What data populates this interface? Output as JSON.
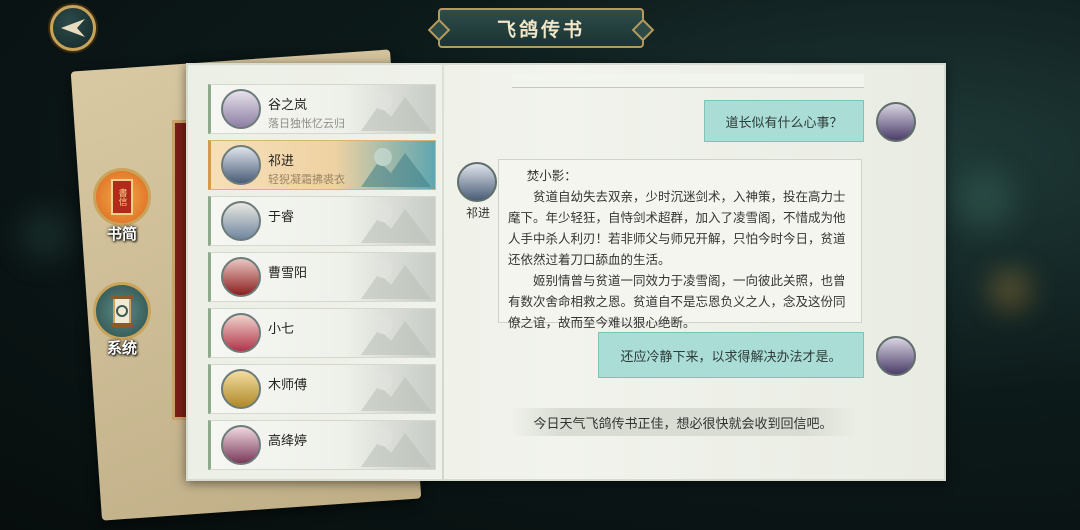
{
  "header": {
    "title": "飞鸽传书"
  },
  "side_menu": [
    {
      "label": "书简",
      "seal_text": "書信"
    },
    {
      "label": "系统"
    }
  ],
  "contacts": [
    {
      "name": "谷之岚",
      "status": "落日独怅忆云归"
    },
    {
      "name": "祁进",
      "status": "轻猊凝霜拂裘衣"
    },
    {
      "name": "于睿",
      "status": ""
    },
    {
      "name": "曹雪阳",
      "status": ""
    },
    {
      "name": "小七",
      "status": ""
    },
    {
      "name": "木师傅",
      "status": ""
    },
    {
      "name": "高绛婷",
      "status": ""
    }
  ],
  "chat": {
    "partner_name": "祁进",
    "messages": [
      {
        "from": "self",
        "text": "道长似有什么心事？"
      },
      {
        "from": "partner",
        "salutation": "焚小影：",
        "paragraphs": [
          "贫道自幼失去双亲，少时沉迷剑术，入神策，投在高力士麾下。年少轻狂，自恃剑术超群，加入了凌雪阁，不惜成为他人手中杀人利刃！若非师父与师兄开解，只怕今时今日，贫道还依然过着刀口舔血的生活。",
          "姬别情曾与贫道一同效力于凌雪阁，一向彼此关照，也曾有数次舍命相救之恩。贫道自不是忘恩负义之人，念及这份同僚之谊，故而至今难以狠心绝断。"
        ]
      },
      {
        "from": "self",
        "text": "还应冷静下来，以求得解决办法才是。"
      }
    ],
    "system_note": "今日天气飞鸽传书正佳，想必很快就会收到回信吧。"
  },
  "colors": {
    "bubble": "#a9ddd6",
    "selected_contact": "#efd2a3",
    "frame_gold": "#c9a55c"
  }
}
